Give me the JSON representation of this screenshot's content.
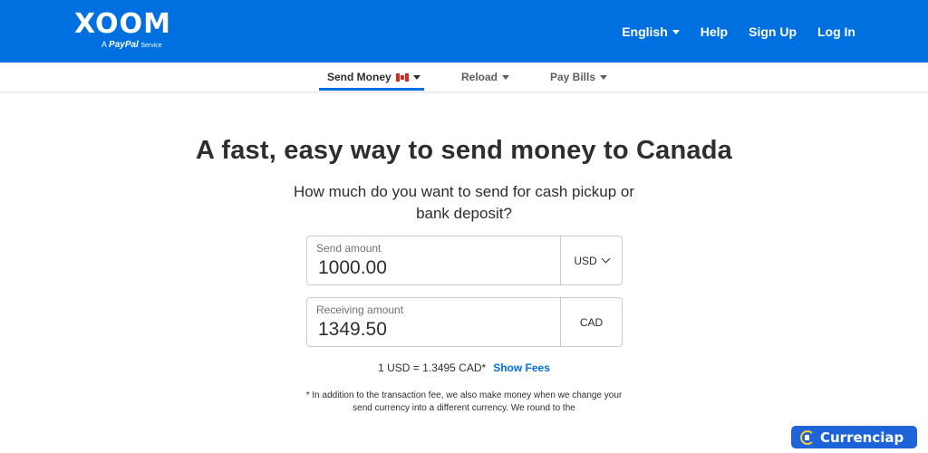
{
  "header": {
    "logo_word": "XOOM",
    "logo_prefix": "A",
    "logo_brand": "PayPal",
    "logo_suffix": "Service",
    "nav": [
      {
        "label": "English"
      },
      {
        "label": "Help"
      },
      {
        "label": "Sign Up"
      },
      {
        "label": "Log In"
      }
    ],
    "brand_color": "#0070e0"
  },
  "subnav": {
    "items": [
      {
        "label": "Send Money",
        "active": true
      },
      {
        "label": "Reload"
      },
      {
        "label": "Pay Bills"
      }
    ]
  },
  "main": {
    "headline": "A fast, easy way to send money to Canada",
    "question": "How much do you want to send for cash pickup or bank deposit?",
    "send": {
      "label": "Send amount",
      "value": "1000.00",
      "currency": "USD"
    },
    "receive": {
      "label": "Receiving amount",
      "value": "1349.50",
      "currency": "CAD"
    },
    "rate": "1 USD = 1.3495 CAD*",
    "show_fees": "Show Fees",
    "disclaimer": "* In addition to the transaction fee, we also make money when we change your send currency into a different currency. We round to the"
  },
  "watermark": {
    "label": "Currenciap",
    "icon": "currenciap-logo-icon"
  }
}
